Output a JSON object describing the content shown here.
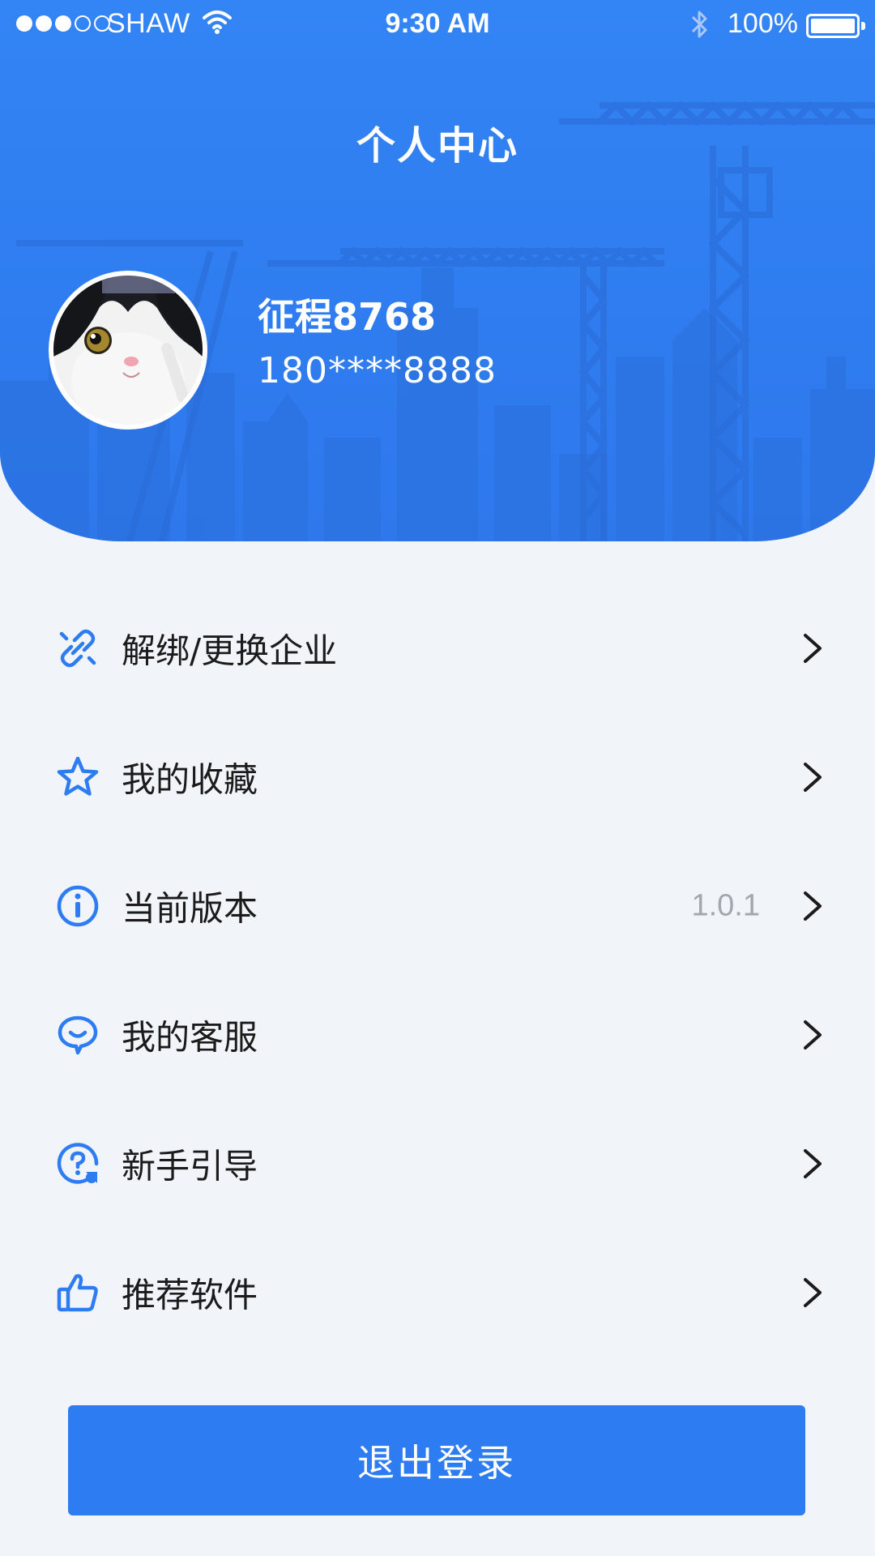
{
  "status_bar": {
    "carrier": "SHAW",
    "time": "9:30 AM",
    "battery": "100%",
    "signal_bars_filled": 3,
    "signal_bars_total": 5
  },
  "header": {
    "title": "个人中心",
    "background_color": "#3080f2"
  },
  "profile": {
    "name": "征程8768",
    "phone": "180****8888"
  },
  "menu": {
    "items": [
      {
        "label": "解绑/更换企业",
        "icon": "unlink-icon",
        "value": ""
      },
      {
        "label": "我的收藏",
        "icon": "star-icon",
        "value": ""
      },
      {
        "label": "当前版本",
        "icon": "info-icon",
        "value": "1.0.1"
      },
      {
        "label": "我的客服",
        "icon": "chat-service-icon",
        "value": ""
      },
      {
        "label": "新手引导",
        "icon": "help-icon",
        "value": ""
      },
      {
        "label": "推荐软件",
        "icon": "thumbs-up-icon",
        "value": ""
      }
    ]
  },
  "logout": {
    "label": "退出登录",
    "color": "#2e7cf2"
  },
  "accent_color": "#2e7cf2"
}
